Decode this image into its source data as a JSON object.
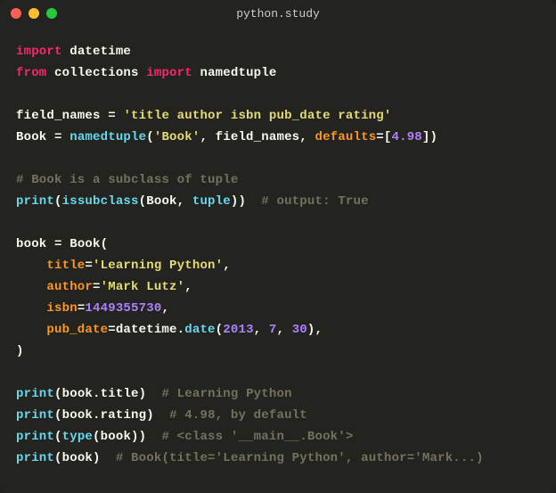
{
  "window": {
    "title": "python.study"
  },
  "code": {
    "l1": {
      "kw1": "import",
      "mod": "datetime"
    },
    "l2": {
      "kw1": "from",
      "mod": "collections",
      "kw2": "import",
      "name": "namedtuple"
    },
    "l3": {
      "var": "field_names",
      "op": " = ",
      "str": "'title author isbn pub_date rating'"
    },
    "l4": {
      "var": "Book",
      "eq": " = ",
      "fn": "namedtuple",
      "op1": "(",
      "str": "'Book'",
      "c1": ", ",
      "arg": "field_names",
      "c2": ", ",
      "kw": "defaults",
      "eq2": "=[",
      "num": "4.98",
      "cl": "])"
    },
    "l5": {
      "cm": "# Book is a subclass of tuple"
    },
    "l6": {
      "fn1": "print",
      "op1": "(",
      "fn2": "issubclass",
      "op2": "(",
      "a1": "Book",
      "c1": ", ",
      "a2": "tuple",
      "cl": "))",
      "sp": "  ",
      "cm": "# output: True"
    },
    "l7": {
      "var": "book",
      "eq": " = ",
      "cls": "Book",
      "op": "("
    },
    "l8": {
      "ind": "    ",
      "kw": "title",
      "eq": "=",
      "str": "'Learning Python'",
      "c": ","
    },
    "l9": {
      "ind": "    ",
      "kw": "author",
      "eq": "=",
      "str": "'Mark Lutz'",
      "c": ","
    },
    "l10": {
      "ind": "    ",
      "kw": "isbn",
      "eq": "=",
      "num": "1449355730",
      "c": ","
    },
    "l11": {
      "ind": "    ",
      "kw": "pub_date",
      "eq": "=",
      "mod": "datetime",
      "dot": ".",
      "fn": "date",
      "op": "(",
      "n1": "2013",
      "c1": ", ",
      "n2": "7",
      "c2": ", ",
      "n3": "30",
      "cl": "),"
    },
    "l12": {
      "cl": ")"
    },
    "l13": {
      "fn": "print",
      "op": "(",
      "obj": "book",
      "dot": ".",
      "attr": "title",
      "cl": ")",
      "sp": "  ",
      "cm": "# Learning Python"
    },
    "l14": {
      "fn": "print",
      "op": "(",
      "obj": "book",
      "dot": ".",
      "attr": "rating",
      "cl": ")",
      "sp": "  ",
      "cm": "# 4.98, by default"
    },
    "l15": {
      "fn": "print",
      "op": "(",
      "fn2": "type",
      "op2": "(",
      "obj": "book",
      "cl": "))",
      "sp": "  ",
      "cm": "# <class '__main__.Book'>"
    },
    "l16": {
      "fn": "print",
      "op": "(",
      "obj": "book",
      "cl": ")",
      "sp": "  ",
      "cm": "# Book(title='Learning Python', author='Mark...)"
    }
  }
}
